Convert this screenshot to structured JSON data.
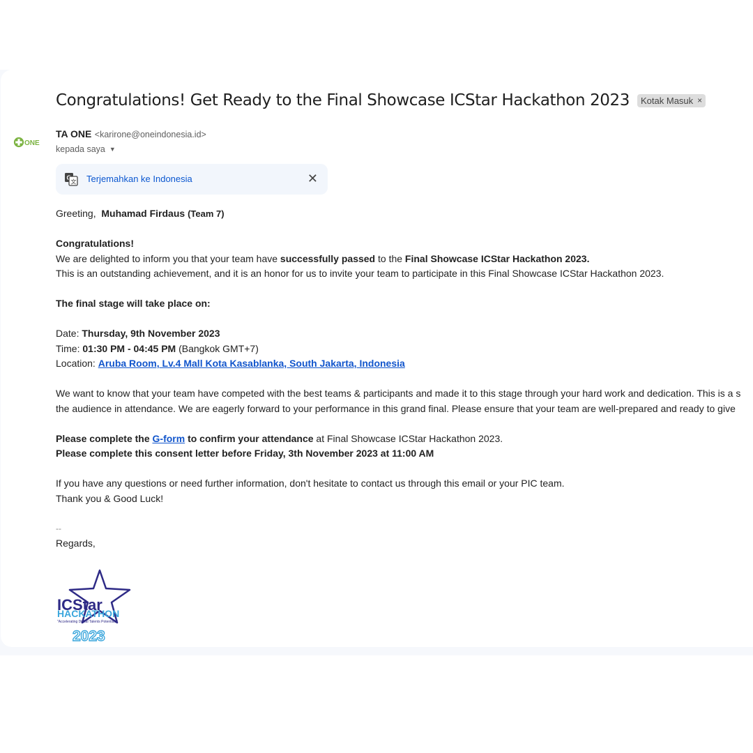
{
  "email": {
    "subject": "Congratulations! Get Ready to the Final Showcase ICStar Hackathon 2023",
    "label_chip": "Kotak Masuk",
    "label_chip_remove": "×",
    "sender_name": "TA ONE",
    "sender_email": "<karirone@oneindonesia.id>",
    "recipient": "kepada saya",
    "avatar_text": "ONE"
  },
  "translate_bar": {
    "label": "Terjemahkan ke Indonesia",
    "close": "✕"
  },
  "body": {
    "greeting_prefix": "Greeting,  ",
    "greeting_name": "Muhamad Firdaus",
    "greeting_team": "(Team 7)",
    "congrats": "Congratulations!",
    "p1_a": "We are delighted to inform you that your team have ",
    "p1_b": "successfully passed",
    "p1_c": " to the ",
    "p1_d": "Final Showcase ICStar Hackathon 2023.",
    "p2": "This is an outstanding achievement, and it is an honor for us to invite your team to participate in this Final Showcase ICStar Hackathon 2023.",
    "stage_heading": "The final stage will take place on:",
    "date_label": "Date: ",
    "date_value": "Thursday, 9th November 2023",
    "time_label": "Time: ",
    "time_value": "01:30 PM - 04:45 PM",
    "time_tz": " (Bangkok GMT+7)",
    "location_label": "Location: ",
    "location_value": "Aruba Room, Lv.4 Mall Kota Kasablanka, South Jakarta, Indonesia",
    "p3_line1": "We want to know that your team have competed with the best teams & participants and made it to this stage through your hard work and dedication. This is a s",
    "p3_line2": "the audience in attendance. We are eagerly forward to your performance in this grand final. Please ensure that your team are well-prepared and ready to give",
    "gform_a": "Please complete the ",
    "gform_link": "G-form",
    "gform_b": " to confirm your attendance",
    "gform_c": " at Final Showcase ICStar Hackathon 2023.",
    "consent": "Please complete this consent letter before Friday, 3th November 2023 at 11:00 AM",
    "questions": "If you have any questions or need further information, don't hesitate to contact us through this email or your PIC team.",
    "thanks": "Thank you & Good Luck!",
    "sig_dash": "--",
    "regards": "Regards,"
  },
  "logo": {
    "line1": "ICStar",
    "line2": "HACKATHON",
    "tagline": "\"Accelerating Digital Talents Potentials\"",
    "year": "2023"
  },
  "colors": {
    "link": "#1155cc",
    "translate_link": "#0b57d0",
    "logo_navy": "#2e2a86",
    "logo_cyan": "#3aa6dc",
    "one_green": "#7cb342"
  }
}
